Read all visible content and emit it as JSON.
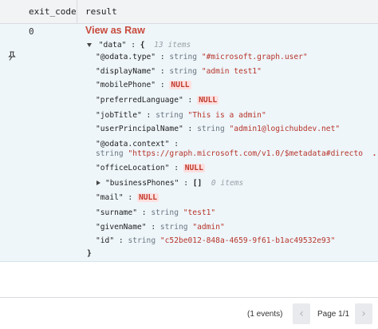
{
  "header": {
    "col_exit": "exit_code",
    "col_result": "result"
  },
  "row": {
    "exit_code": "0",
    "view_raw_label": "View as Raw",
    "root": {
      "key": "\"data\"",
      "colon": ":",
      "open": "{",
      "meta": "13 items",
      "close": "}"
    },
    "fields": [
      {
        "key": "\"@odata.type\"",
        "type": "string",
        "value": "\"#microsoft.graph.user\""
      },
      {
        "key": "\"displayName\"",
        "type": "string",
        "value": "\"admin test1\""
      },
      {
        "key": "\"mobilePhone\"",
        "null": "NULL"
      },
      {
        "key": "\"preferredLanguage\"",
        "null": "NULL"
      },
      {
        "key": "\"jobTitle\"",
        "type": "string",
        "value": "\"This is a admin\""
      },
      {
        "key": "\"userPrincipalName\"",
        "type": "string",
        "value": "\"admin1@logichubdev.net\""
      },
      {
        "key": "\"@odata.context\"",
        "type": "string",
        "value": "\"https://graph.microsoft.com/v1.0/$metadata#directo",
        "ellipsis": "...\""
      },
      {
        "key": "\"officeLocation\"",
        "null": "NULL"
      },
      {
        "key": "\"businessPhones\"",
        "array": "[]",
        "meta": "0 items"
      },
      {
        "key": "\"mail\"",
        "null": "NULL"
      },
      {
        "key": "\"surname\"",
        "type": "string",
        "value": "\"test1\""
      },
      {
        "key": "\"givenName\"",
        "type": "string",
        "value": "\"admin\""
      },
      {
        "key": "\"id\"",
        "type": "string",
        "value": "\"c52be012-848a-4659-9f61-b1ac49532e93\""
      }
    ]
  },
  "footer": {
    "events": "(1 events)",
    "page_label": "Page 1/1",
    "prev_icon": "chevron-left-icon",
    "next_icon": "chevron-right-icon"
  }
}
